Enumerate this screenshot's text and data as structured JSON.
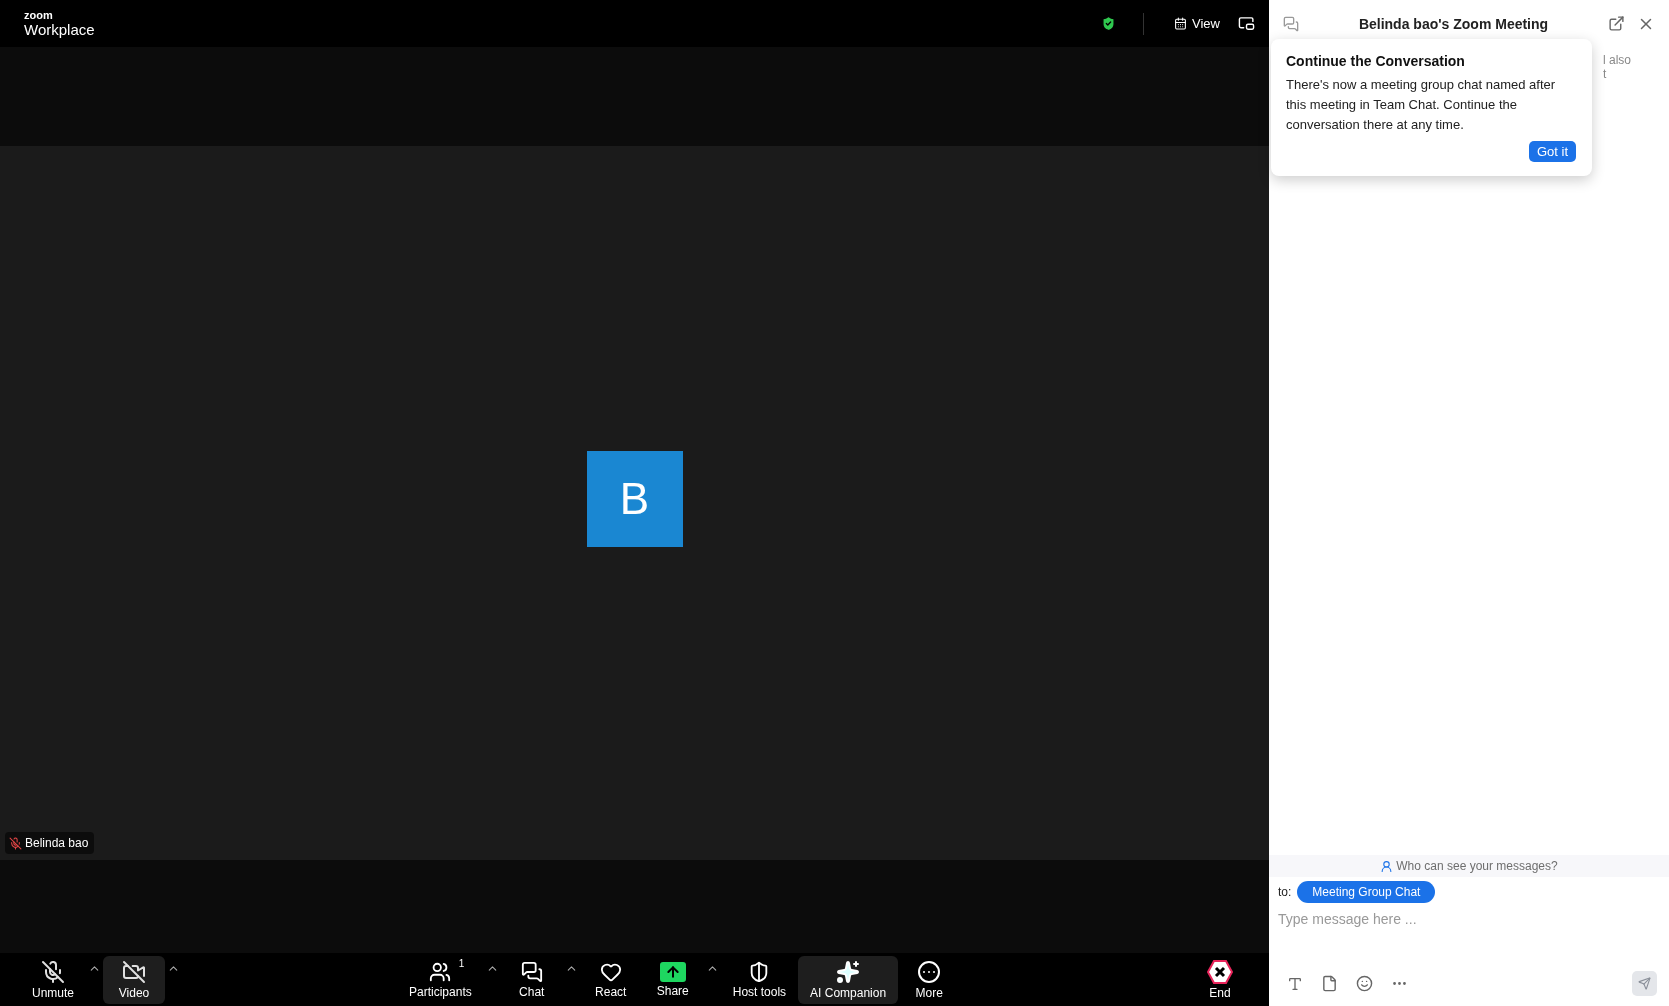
{
  "header": {
    "logo_small": "zoom",
    "logo_large": "Workplace",
    "view_label": "View"
  },
  "video": {
    "avatar_letter": "B",
    "name": "Belinda bao",
    "muted": true
  },
  "toolbar": {
    "left": [
      {
        "kind": "unmute",
        "label": "Unmute",
        "caret": true,
        "highlighted": false
      },
      {
        "kind": "video",
        "label": "Video",
        "caret": true,
        "highlighted": true
      }
    ],
    "center": [
      {
        "kind": "participants",
        "label": "Participants",
        "badge": "1",
        "caret": true,
        "highlighted": false
      },
      {
        "kind": "chat",
        "label": "Chat",
        "caret": true,
        "highlighted": false
      },
      {
        "kind": "react",
        "label": "React",
        "caret": false,
        "highlighted": false
      },
      {
        "kind": "share",
        "label": "Share",
        "caret": true,
        "highlighted": false
      },
      {
        "kind": "host",
        "label": "Host tools",
        "caret": false,
        "highlighted": false
      },
      {
        "kind": "ai",
        "label": "AI Companion",
        "caret": false,
        "highlighted": true
      },
      {
        "kind": "more",
        "label": "More",
        "caret": false,
        "highlighted": false
      }
    ],
    "end": {
      "label": "End"
    }
  },
  "chat_panel": {
    "title": "Belinda bao's Zoom Meeting",
    "hidden_notice": [
      "l also",
      "t"
    ],
    "popover": {
      "title": "Continue the Conversation",
      "body": "There's now a meeting group chat named after this meeting in Team Chat. Continue the conversation there at any time.",
      "button": "Got it"
    },
    "privacy_link": "Who can see your messages?",
    "to_label": "to:",
    "recipient": "Meeting Group Chat",
    "input": {
      "placeholder": "Type message here ..."
    }
  }
}
